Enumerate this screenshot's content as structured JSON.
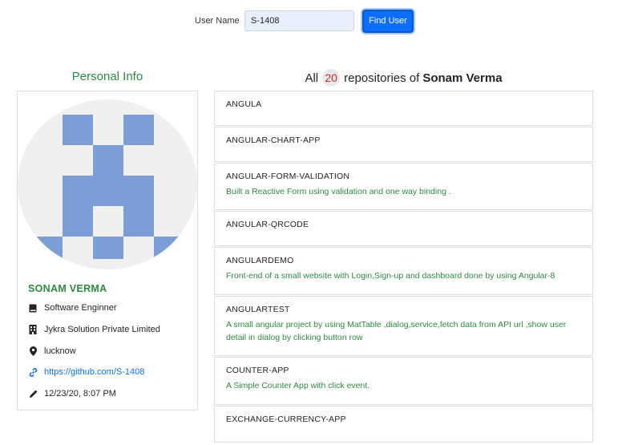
{
  "search": {
    "label": "User Name",
    "value": "S-1408",
    "button_label": "Find User"
  },
  "personal_info": {
    "heading": "Personal Info",
    "name": "SONAM VERMA",
    "job": "Software Enginner",
    "company": "Jykra Solution Private Limited",
    "location": "lucknow",
    "profile_url": "https://github.com/S-1408",
    "updated": "12/23/20, 8:07 PM"
  },
  "repos_header": {
    "prefix": "All",
    "count": "20",
    "middle": "repositories of",
    "user": "Sonam Verma"
  },
  "repos": [
    {
      "name": "ANGULA",
      "description": ""
    },
    {
      "name": "ANGULAR-CHART-APP",
      "description": ""
    },
    {
      "name": "ANGULAR-FORM-VALIDATION",
      "description": "Built a Reactive Form using validation and one way binding ."
    },
    {
      "name": "ANGULAR-QRCODE",
      "description": ""
    },
    {
      "name": "ANGULARDEMO",
      "description": "Front-end of a small website with Login,Sign-up and dashboard done by using Angular-8"
    },
    {
      "name": "ANGULARTEST",
      "description": "A small angular project by using MatTable ,dialog,service,fetch data from API url ,show user detail in dialog by clicking button row"
    },
    {
      "name": "COUNTER-APP",
      "description": "A Simple Counter App with click event."
    },
    {
      "name": "EXCHANGE-CURRENCY-APP",
      "description": ""
    }
  ],
  "colors": {
    "accent_green": "#2e8b3e",
    "primary_blue": "#0d6efd",
    "badge_red": "#d02b2b",
    "avatar_blue": "#7b9ed6"
  }
}
